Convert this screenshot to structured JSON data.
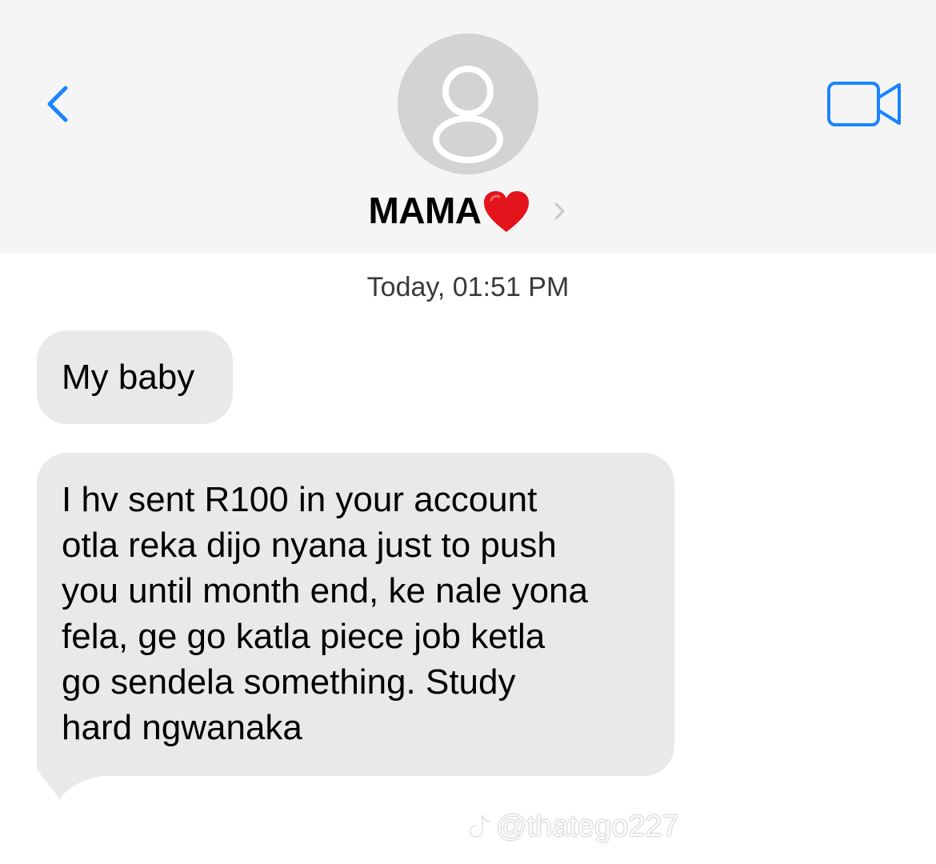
{
  "header": {
    "contact_name": "MAMA",
    "icons": {
      "back": "chevron-left-icon",
      "avatar": "person-icon",
      "contact_emoji": "red-heart-icon",
      "contact_chevron": "chevron-right-icon",
      "video": "video-camera-icon"
    }
  },
  "thread": {
    "timestamp": "Today, 01:51 PM",
    "messages": [
      {
        "direction": "incoming",
        "text": "My baby"
      },
      {
        "direction": "incoming",
        "text": "I hv sent R100 in your account\notla reka dijo nyana just to push\nyou until month end, ke nale yona\nfela, ge go katla piece job ketla\ngo sendela something. Study\nhard ngwanaka"
      }
    ]
  },
  "watermark": {
    "handle": "@thatego227",
    "icon": "tiktok-icon"
  },
  "colors": {
    "accent": "#1a84ff",
    "header_bg": "#f5f5f5",
    "incoming_bubble": "#e9e9eb",
    "avatar_bg": "#d3d3d3",
    "heart": "#e3141b"
  }
}
